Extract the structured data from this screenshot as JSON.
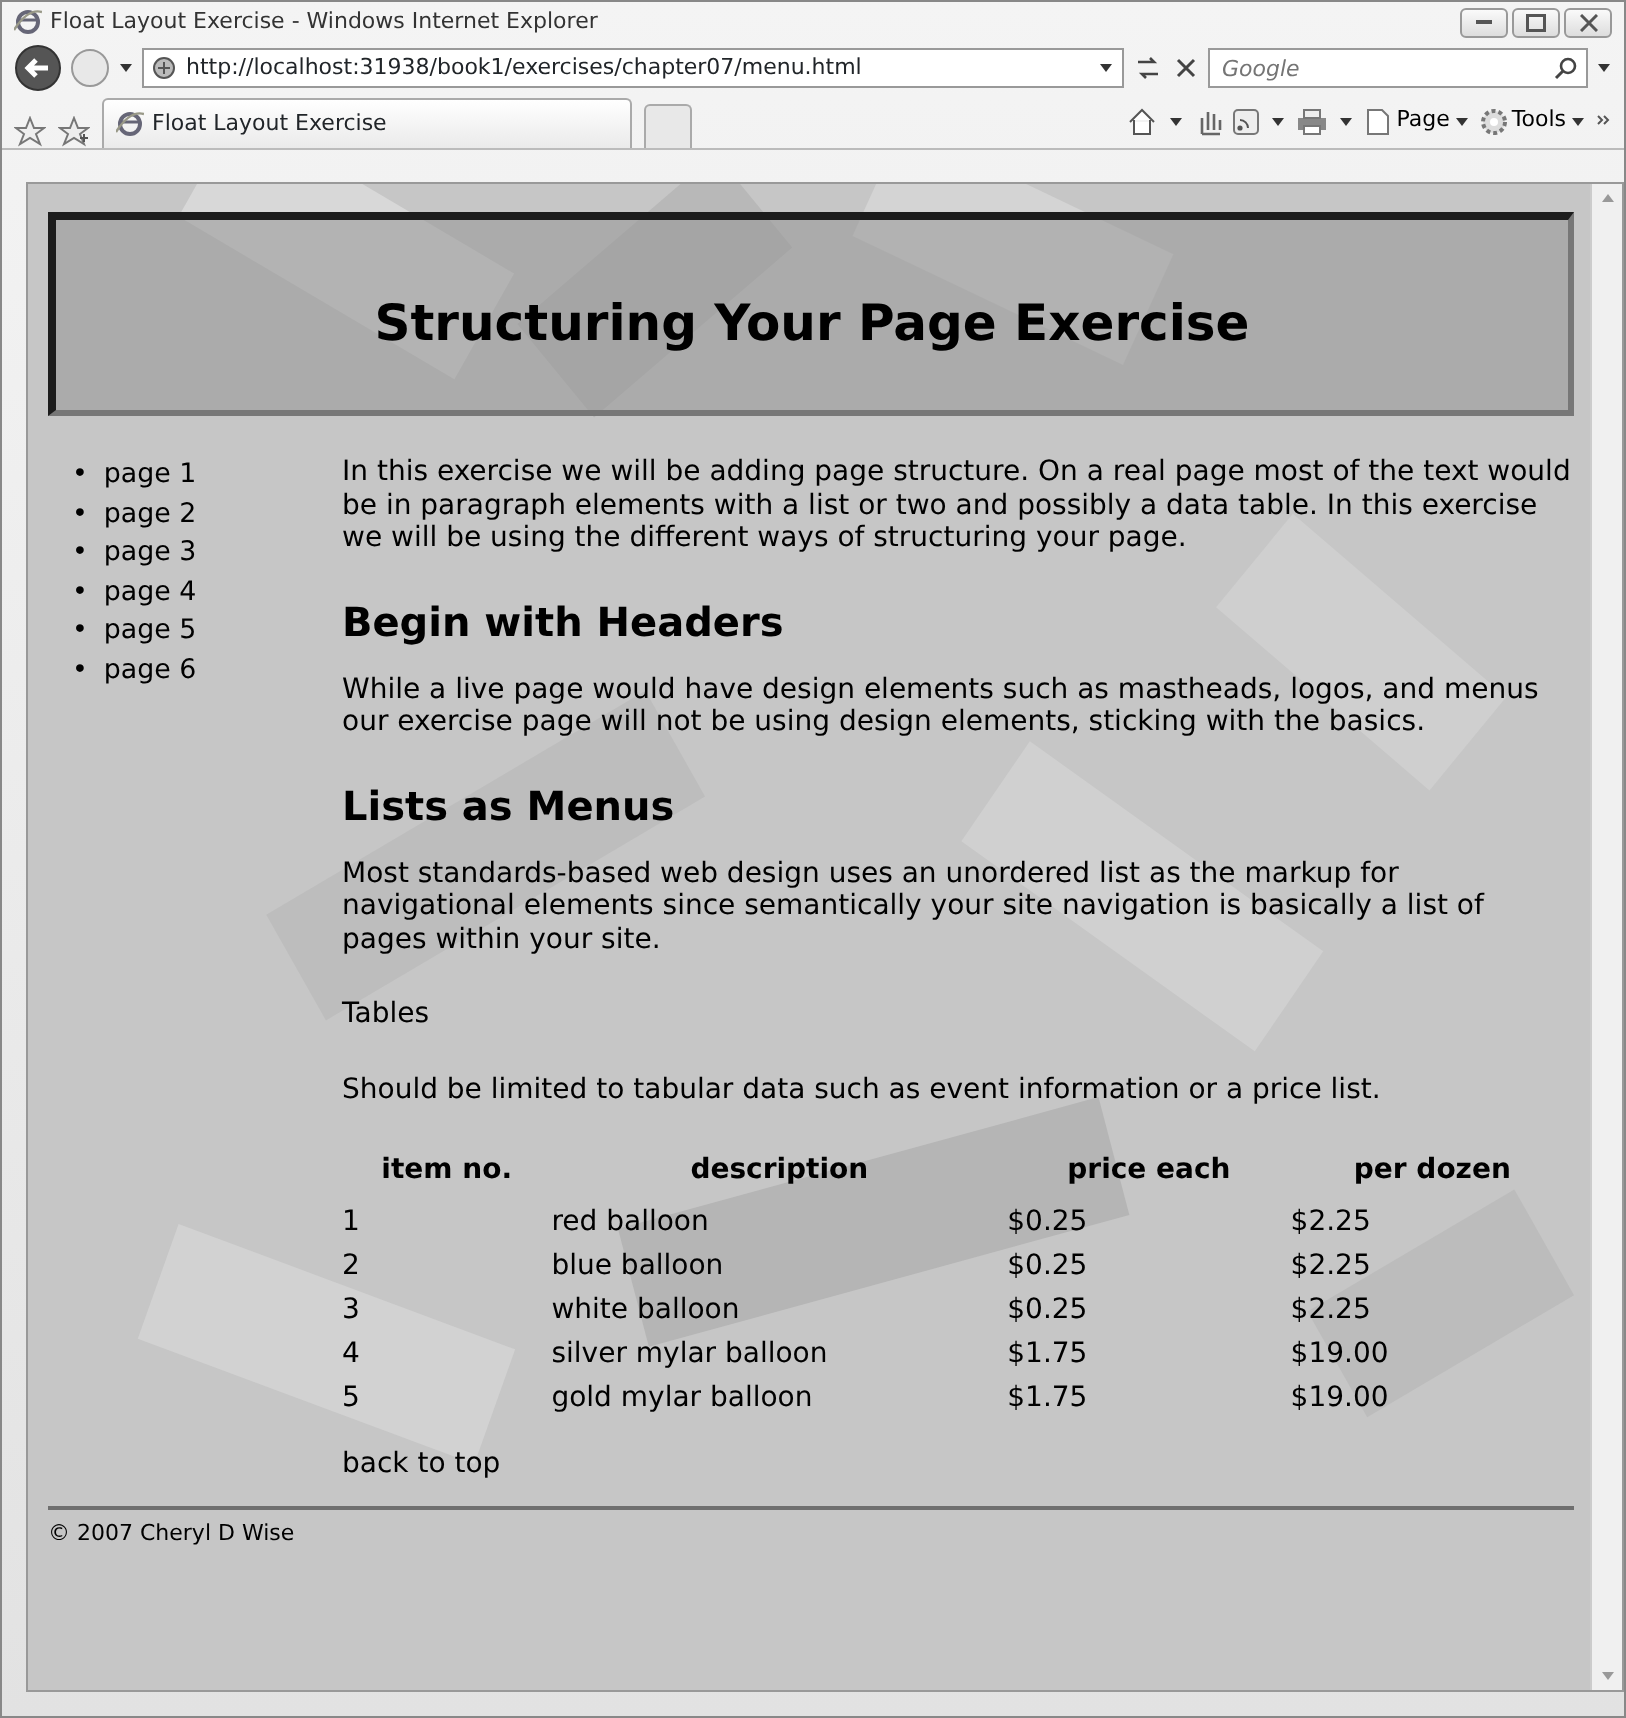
{
  "window": {
    "title": "Float Layout Exercise - Windows Internet Explorer"
  },
  "address_bar": {
    "url": "http://localhost:31938/book1/exercises/chapter07/menu.html"
  },
  "search": {
    "placeholder": "Google"
  },
  "tabs": [
    {
      "label": "Float Layout Exercise",
      "selected": true
    }
  ],
  "toolbar": {
    "buttons": [
      "Page",
      "Tools"
    ]
  },
  "page": {
    "heading": "Structuring Your Page Exercise",
    "nav": [
      {
        "bullet": "•",
        "label": "page 1"
      },
      {
        "bullet": "•",
        "label": "page 2"
      },
      {
        "bullet": "•",
        "label": "page 3"
      },
      {
        "bullet": "•",
        "label": "page 4"
      },
      {
        "bullet": "•",
        "label": "page 5"
      },
      {
        "bullet": "•",
        "label": "page 6"
      }
    ],
    "content": [
      {
        "kind": "paragraph",
        "text": "In this exercise we will be adding page structure. On a real page most of the text would be in paragraph elements with a list or two and possibly a data table. In this exercise we will be using the different ways of structuring your page."
      },
      {
        "kind": "heading",
        "text": "Begin with Headers"
      },
      {
        "kind": "paragraph",
        "text": "While a live page would have design elements such as mastheads, logos, and menus our exercise page will not be using design elements, sticking with the basics."
      },
      {
        "kind": "heading",
        "text": "Lists as Menus"
      },
      {
        "kind": "paragraph",
        "text": "Most standards-based web design uses an unordered list as the markup for navigational elements since semantically your site navigation is basically a list of pages within your site."
      },
      {
        "kind": "paragraph",
        "text": "Tables"
      },
      {
        "kind": "paragraph",
        "text": "Should be limited to tabular data such as event information or a price list."
      }
    ],
    "table": {
      "columns": [
        "item no.",
        "description",
        "price each",
        "per dozen"
      ],
      "rows": [
        [
          "1",
          "red balloon",
          "$0.25",
          "$2.25"
        ],
        [
          "2",
          "blue balloon",
          "$0.25",
          "$2.25"
        ],
        [
          "3",
          "white balloon",
          "$0.25",
          "$2.25"
        ],
        [
          "4",
          "silver mylar balloon",
          "$1.75",
          "$19.00"
        ],
        [
          "5",
          "gold mylar balloon",
          "$1.75",
          "$19.00"
        ]
      ]
    },
    "back_link": "back to top",
    "footer": "© 2007 Cheryl D Wise"
  }
}
